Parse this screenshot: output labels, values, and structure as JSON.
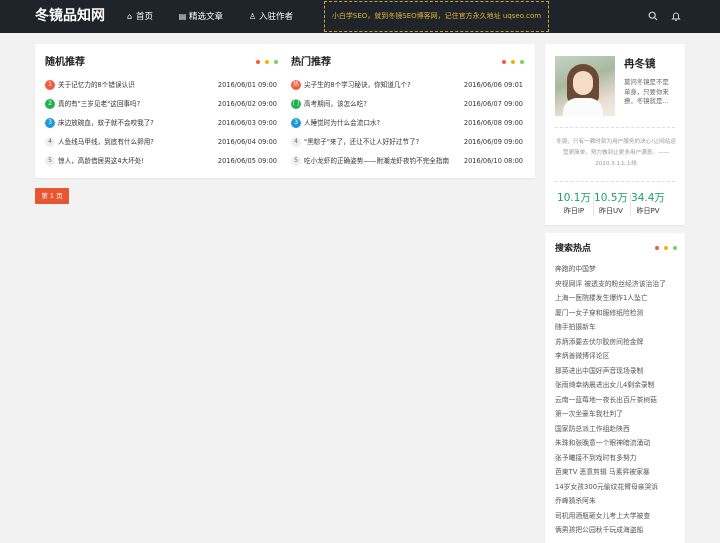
{
  "header": {
    "logo": "冬镜品知网",
    "nav": [
      {
        "label": "首页",
        "icon": "home-icon",
        "glyph": "⌂"
      },
      {
        "label": "精选文章",
        "icon": "document-icon",
        "glyph": "▤"
      },
      {
        "label": "入驻作者",
        "icon": "user-icon",
        "glyph": "♙"
      }
    ],
    "notice": "小白学SEO，就到冬镜SEO博客网，记住官方永久地址 uqseo.com",
    "search_icon": "search-icon",
    "bell_icon": "bell-icon"
  },
  "random": {
    "title": "随机推荐",
    "items": [
      {
        "n": "1",
        "title": "关于记忆力的8个错误认识",
        "date": "2016/06/01 09:00"
      },
      {
        "n": "2",
        "title": "真的有\"三岁见老\"这回事吗?",
        "date": "2016/06/02 09:00"
      },
      {
        "n": "3",
        "title": "床边放碗血，蚊子就不会咬我了?",
        "date": "2016/06/03 09:00"
      },
      {
        "n": "4",
        "title": "人鱼线马甲线，到底有什么卵用?",
        "date": "2016/06/04 09:00"
      },
      {
        "n": "5",
        "title": "惊人，高龄借居男这4大坏处!",
        "date": "2016/06/05 09:00"
      }
    ]
  },
  "popular": {
    "title": "热门推荐",
    "items": [
      {
        "n": "热",
        "title": "尖子生的8个学习秘诀，你知道几个?",
        "date": "2016/06/06 09:01"
      },
      {
        "n": "门",
        "title": "高考期间，该怎么吃?",
        "date": "2016/06/07 09:00"
      },
      {
        "n": "3",
        "title": "人睡觉时为什么会流口水?",
        "date": "2016/06/08 09:00"
      },
      {
        "n": "4",
        "title": "\"黑粽子\"来了，还让不让人好好过节了?",
        "date": "2016/06/09 09:00"
      },
      {
        "n": "5",
        "title": "吃小龙虾的正确姿势——附潮龙虾夜钓不完全指南",
        "date": "2016/06/10 08:00"
      }
    ]
  },
  "pagination": {
    "current": "第 1 页"
  },
  "author": {
    "name": "冉冬镜",
    "bio": "莫问冬镜是不是单身，只要你来撩，冬镜就是...",
    "motto": "冬镜，只有一颗时刻为用户服务的决心!让网站运营更简单，努力做到让更多用户满意。——2020.3.1上上线",
    "stats": [
      {
        "value": "10.1万",
        "label": "昨日IP"
      },
      {
        "value": "10.5万",
        "label": "昨日UV"
      },
      {
        "value": "34.4万",
        "label": "昨日PV"
      }
    ]
  },
  "hot_search": {
    "title": "搜索热点",
    "items": [
      "奔跑的中国梦",
      "央视网评 被透支的粉丝经济该治治了",
      "上海一医院楼发生爆炸1人坠亡",
      "厦门一女子穿和服修纸险检测",
      "随手拍摄新车",
      "苏炳添要去伏尔胶房间抢金牌",
      "李炳善微博评论区",
      "那英进出中国好声音现场录制",
      "张雨绮幸纳晨进出女儿4剩余录制",
      "云南一蓝莓地一夜长出百斤茶树菇",
      "第一次坐豪车我杜判了",
      "国家防总派工作组赴陕西",
      "朱珠和张晚意一个眼神暗流涌动",
      "张予曦接不到戏时有多努力",
      "芭東TV 恶意剪辑  马素昇被家暴",
      "14岁女孩300元偷纹花臂母亲哭诉",
      "乔峰猜杀阿朱",
      "司机用酒瓶砸女儿考上大学被查",
      "俩男孩把公园秋千玩成海盗船"
    ]
  },
  "colors": {
    "accent": "#e8552f",
    "green": "#1aa16a",
    "notice": "#e0b23c",
    "badges": [
      "#f25b3c",
      "#22b14c",
      "#1e9bd7"
    ]
  }
}
